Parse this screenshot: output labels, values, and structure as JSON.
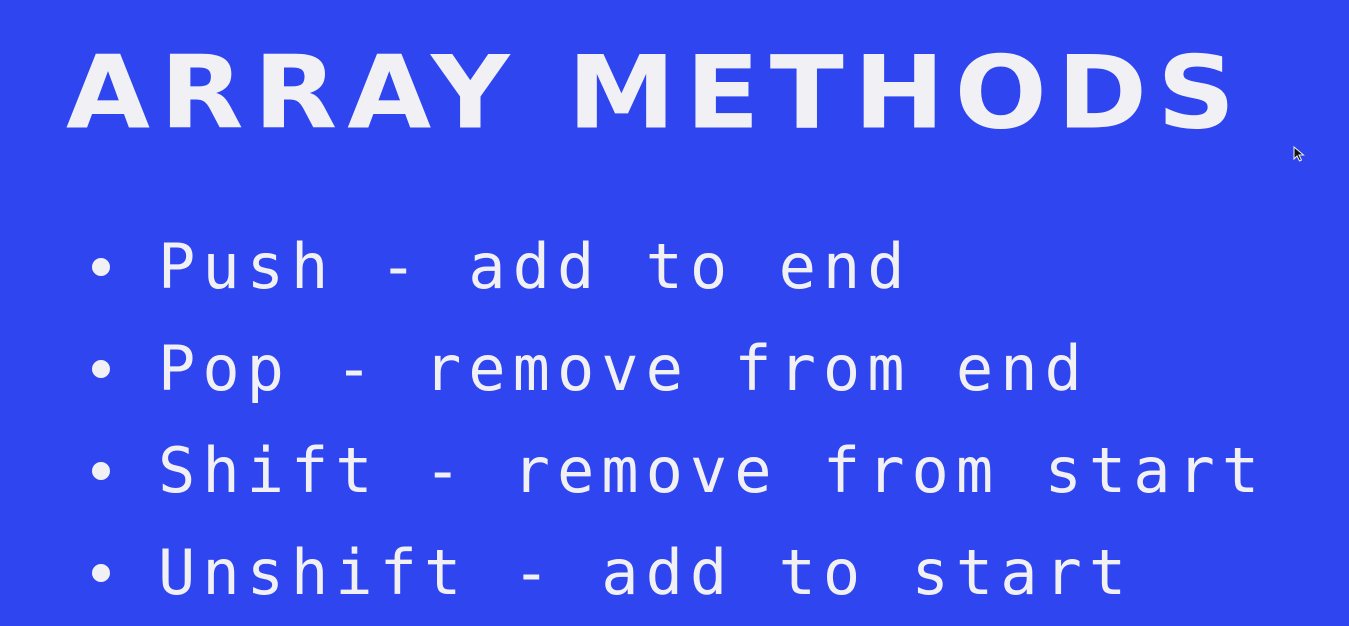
{
  "slide": {
    "title": "ARRAY METHODS",
    "bullets": [
      "Push - add to end",
      "Pop - remove from end",
      "Shift - remove from start",
      "Unshift - add to start"
    ]
  },
  "colors": {
    "background": "#2f45f0",
    "text": "#f1f1f5"
  },
  "icons": {
    "cursor": "mouse-pointer-icon",
    "bullet": "bullet-dot-icon"
  }
}
